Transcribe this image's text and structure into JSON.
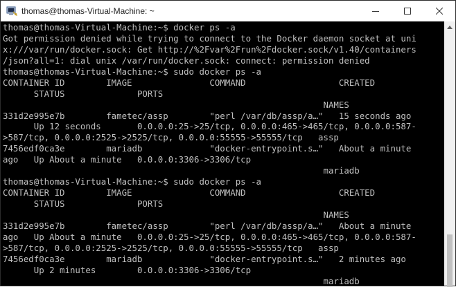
{
  "window": {
    "title": "thomas@thomas-Virtual-Machine: ~",
    "icons": {
      "app": "putty-terminal-icon",
      "minimize": "minimize-icon",
      "maximize": "maximize-icon",
      "close": "close-icon"
    }
  },
  "terminal": {
    "colors": {
      "background": "#000000",
      "text": "#c0c0c0"
    },
    "lines": [
      "thomas@thomas-Virtual-Machine:~$ docker ps -a",
      "Got permission denied while trying to connect to the Docker daemon socket at uni",
      "x:///var/run/docker.sock: Get http://%2Fvar%2Frun%2Fdocker.sock/v1.40/containers",
      "/json?all=1: dial unix /var/run/docker.sock: connect: permission denied",
      "thomas@thomas-Virtual-Machine:~$ sudo docker ps -a",
      "CONTAINER ID        IMAGE               COMMAND                  CREATED",
      "      STATUS              PORTS",
      "                                                              NAMES",
      "331d2e995e7b        fametec/assp        \"perl /var/db/assp/a…\"   15 seconds ago",
      "      Up 12 seconds       0.0.0.0:25->25/tcp, 0.0.0.0:465->465/tcp, 0.0.0.0:587-",
      ">587/tcp, 0.0.0.0:2525->2525/tcp, 0.0.0.0:55555->55555/tcp   assp",
      "7456edf0ca3e        mariadb             \"docker-entrypoint.s…\"   About a minute",
      "ago   Up About a minute   0.0.0.0:3306->3306/tcp",
      "                                                              mariadb",
      "thomas@thomas-Virtual-Machine:~$ sudo docker ps -a",
      "CONTAINER ID        IMAGE               COMMAND                  CREATED",
      "      STATUS              PORTS",
      "                                                              NAMES",
      "331d2e995e7b        fametec/assp        \"perl /var/db/assp/a…\"   About a minute",
      "ago   Up About a minute   0.0.0.0:25->25/tcp, 0.0.0.0:465->465/tcp, 0.0.0.0:587-",
      ">587/tcp, 0.0.0.0:2525->2525/tcp, 0.0.0.0:55555->55555/tcp   assp",
      "7456edf0ca3e        mariadb             \"docker-entrypoint.s…\"   2 minutes ago",
      "      Up 2 minutes        0.0.0.0:3306->3306/tcp",
      "                                                              mariadb"
    ]
  }
}
